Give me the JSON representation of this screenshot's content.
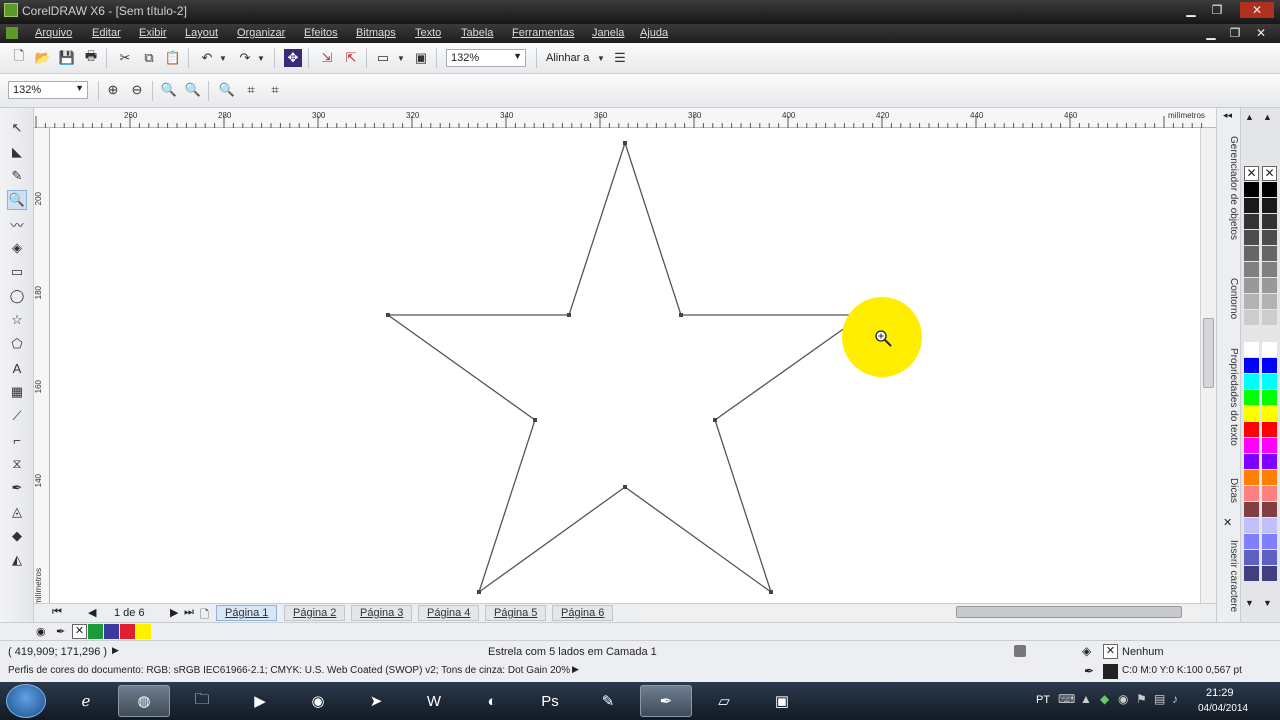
{
  "window": {
    "title": "CorelDRAW X6 - [Sem título-2]"
  },
  "menu": [
    "Arquivo",
    "Editar",
    "Exibir",
    "Layout",
    "Organizar",
    "Efeitos",
    "Bitmaps",
    "Texto",
    "Tabela",
    "Ferramentas",
    "Janela",
    "Ajuda"
  ],
  "toolbar": {
    "zoom_value": "132%",
    "align_label": "Alinhar a"
  },
  "propbar": {
    "zoom_value": "132%"
  },
  "ruler": {
    "top_labels": [
      "260",
      "280",
      "300",
      "320",
      "340",
      "360",
      "380",
      "400",
      "420",
      "440",
      "460"
    ],
    "unit": "milímetros",
    "left_labels": [
      "200",
      "180",
      "160",
      "140"
    ],
    "left_unit": "milímetros"
  },
  "docker_tabs": [
    "Gerenciador de objetos",
    "Contorno",
    "Propriedades do texto",
    "Dicas",
    "Inserir caractere"
  ],
  "pages": {
    "counter": "1 de 6",
    "tabs": [
      "Página 1",
      "Página 2",
      "Página 3",
      "Página 4",
      "Página 5",
      "Página 6"
    ],
    "active": 0
  },
  "status": {
    "coords": "( 419,909; 171,296 )",
    "object_info": "Estrela com 5 lados em Camada 1",
    "color_profile": "Perfis de cores do documento: RGB: sRGB IEC61966-2.1; CMYK: U.S. Web Coated (SWOP) v2; Tons de cinza: Dot Gain 20%",
    "fill": "Nenhum",
    "outline": "C:0 M:0 Y:0 K:100  0,567 pt"
  },
  "taskbar": {
    "lang": "PT",
    "time": "21:29",
    "date": "04/04/2014"
  },
  "colors": {
    "highlight": "#ffee00",
    "palette": [
      "#000000",
      "#1a1a1a",
      "#333333",
      "#4d4d4d",
      "#666666",
      "#808080",
      "#999999",
      "#b3b3b3",
      "#cccccc",
      "#e6e6e6",
      "#ffffff",
      "#0000ff",
      "#00ffff",
      "#00ff00",
      "#ffff00",
      "#ff0000",
      "#ff00ff",
      "#8000ff",
      "#ff8000",
      "#ff8080",
      "#804040",
      "#c0c0ff",
      "#8080ff",
      "#6060c0",
      "#404080"
    ]
  }
}
